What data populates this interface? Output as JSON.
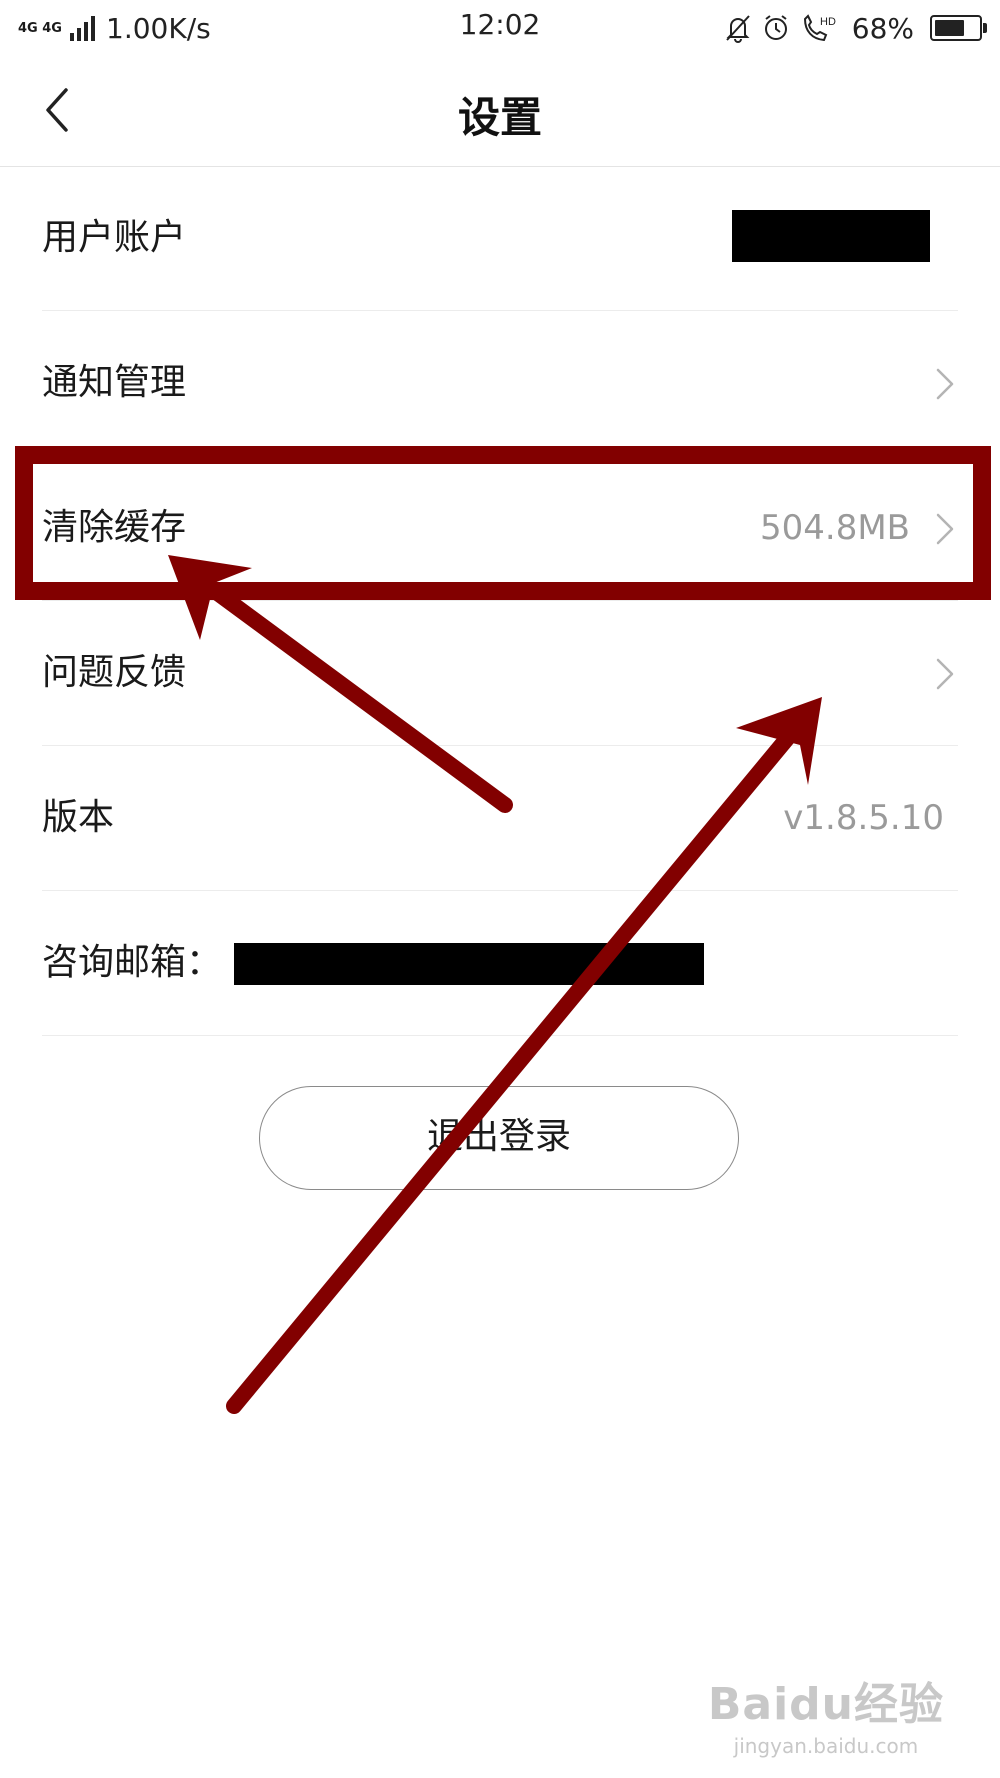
{
  "status_bar": {
    "network": "4G 4G",
    "speed": "1.00K/s",
    "time": "12:02",
    "battery_percent": "68%",
    "battery_level": 0.68,
    "icons": [
      "mute-icon",
      "alarm-icon",
      "hd-call-icon",
      "battery-icon"
    ]
  },
  "header": {
    "title": "设置",
    "back_icon": "chevron-left-icon"
  },
  "settings": [
    {
      "label": "用户账户",
      "value": "",
      "redacted": true
    },
    {
      "label": "通知管理",
      "value": ""
    },
    {
      "label": "清除缓存",
      "value": "504.8MB"
    },
    {
      "label": "问题反馈",
      "value": ""
    },
    {
      "label": "版本",
      "value": "v1.8.5.10"
    },
    {
      "label": "咨询邮箱：",
      "value": "",
      "redacted": true
    }
  ],
  "logout_label": "退出登录",
  "watermark": {
    "logo": "Baidu经验",
    "url": "jingyan.baidu.com"
  },
  "annotation": {
    "color": "#820000",
    "highlighted_item": "清除缓存"
  }
}
